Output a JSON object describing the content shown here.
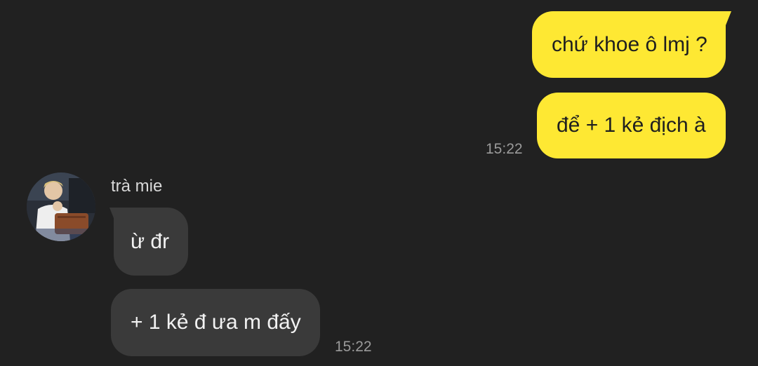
{
  "chat": {
    "contact_name": "trà mie",
    "outgoing": [
      {
        "text": "chứ khoe ô lmj ?"
      },
      {
        "text": "để + 1 kẻ địch à"
      }
    ],
    "outgoing_time": "15:22",
    "incoming": [
      {
        "text": "ừ đr"
      },
      {
        "text": "+ 1 kẻ đ ưa m đấy"
      }
    ],
    "incoming_time": "15:22"
  },
  "colors": {
    "background": "#212121",
    "outgoing_bubble": "#fee833",
    "incoming_bubble": "#3a3a3a",
    "timestamp": "#9a9a9a"
  }
}
